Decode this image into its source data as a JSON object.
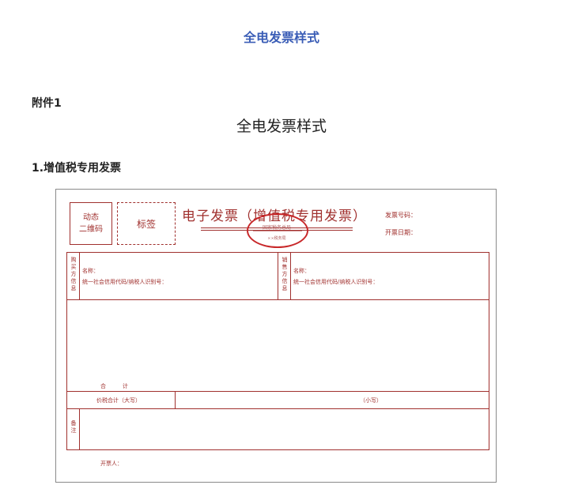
{
  "header": {
    "title": "全电发票样式"
  },
  "attachment_label": "附件1",
  "doc_subtitle": "全电发票样式",
  "section_heading": "1.增值税专用发票",
  "invoice": {
    "qr_text": "动态\n二维码",
    "tag_text": "标签",
    "title": "电子发票（增值税专用发票）",
    "seal_top": "国家税务总局",
    "seal_bottom": "××税务局",
    "invoice_number_label": "发票号码：",
    "issue_date_label": "开票日期：",
    "buyer_side_label": "购\n买\n方\n信\n息",
    "seller_side_label": "销\n售\n方\n信\n息",
    "buyer_name_label": "名称：",
    "buyer_tax_id_label": "统一社会信用代码/纳税人识别号：",
    "seller_name_label": "名称：",
    "seller_tax_id_label": "统一社会信用代码/纳税人识别号：",
    "total_label": "合　　　计",
    "total_in_words_label": "价税合计（大写）",
    "total_in_figures_label": "（小写）",
    "remarks_label": "备\n注",
    "issuer_label": "开票人："
  }
}
